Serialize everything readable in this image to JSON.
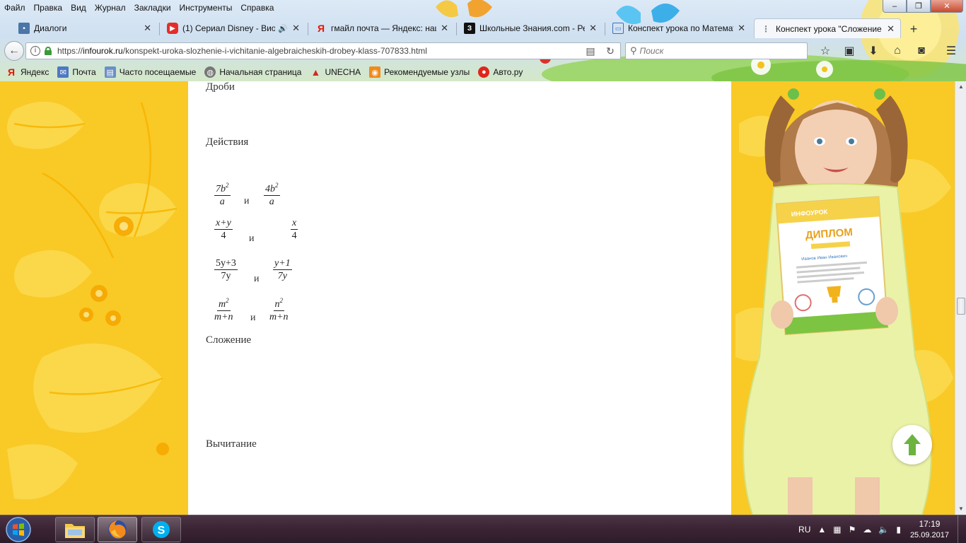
{
  "menu": [
    "Файл",
    "Правка",
    "Вид",
    "Журнал",
    "Закладки",
    "Инструменты",
    "Справка"
  ],
  "window_controls": {
    "minimize": "–",
    "restore": "❐",
    "close": "✕"
  },
  "tabs": [
    {
      "title": "Диалоги",
      "icon": "chat-icon"
    },
    {
      "title": "(1) Сериал Disney - Виол",
      "icon": "youtube-icon",
      "audio": "🔊"
    },
    {
      "title": "гмайл почта — Яндекс: наш",
      "icon": "yandex-icon"
    },
    {
      "title": "Школьные Знания.com - Ре",
      "icon": "znanija-icon"
    },
    {
      "title": "Конспект урока по Математ",
      "icon": "monitor-icon"
    },
    {
      "title": "Конспект урока \"Сложение",
      "icon": "page-icon",
      "active": true
    }
  ],
  "tab_close": "✕",
  "new_tab": "+",
  "url": {
    "prefix": "https://",
    "host": "infourok.ru",
    "path": "/konspekt-uroka-slozhenie-i-vichitanie-algebraicheskih-drobey-klass-707833.html"
  },
  "search": {
    "placeholder": "Поиск"
  },
  "bookmarks": [
    {
      "label": "Яндекс",
      "icon": "yandex-icon"
    },
    {
      "label": "Почта",
      "icon": "mail-icon"
    },
    {
      "label": "Часто посещаемые",
      "icon": "frequent-icon"
    },
    {
      "label": "Начальная страница",
      "icon": "globe-icon"
    },
    {
      "label": "UNECHA",
      "icon": "unecha-icon"
    },
    {
      "label": "Рекомендуемые узлы",
      "icon": "feed-icon"
    },
    {
      "label": "Авто.ру",
      "icon": "auto-icon"
    }
  ],
  "article": {
    "fractions_heading": "Дроби",
    "actions_heading": "Действия",
    "and_word": "и",
    "pairs": [
      [
        {
          "num": "7b",
          "num_sup": "2",
          "den": "a"
        },
        {
          "num": "4b",
          "num_sup": "2",
          "den": "a"
        }
      ],
      [
        {
          "num": "x+y",
          "den": "4"
        },
        {
          "num": "x",
          "den": "4"
        }
      ],
      [
        {
          "num": "5y+3",
          "den": "7y"
        },
        {
          "num": "y+1",
          "den": "7y"
        }
      ],
      [
        {
          "num": "m",
          "num_sup": "2",
          "den": "m+n"
        },
        {
          "num": "n",
          "num_sup": "2",
          "den": "m+n"
        }
      ]
    ],
    "addition_heading": "Сложение",
    "subtraction_heading": "Вычитание"
  },
  "promo": {
    "brand": "ИНФОУРОК",
    "diploma_title": "ДИПЛОМ",
    "recipient": "Иванов Иван Иванович"
  },
  "taskbar": {
    "language": "RU",
    "time": "17:19",
    "date": "25.09.2017"
  },
  "colors": {
    "page_bg": "#f9c926",
    "leaf": "#fbd84a",
    "accent_green": "#6cb33f"
  }
}
